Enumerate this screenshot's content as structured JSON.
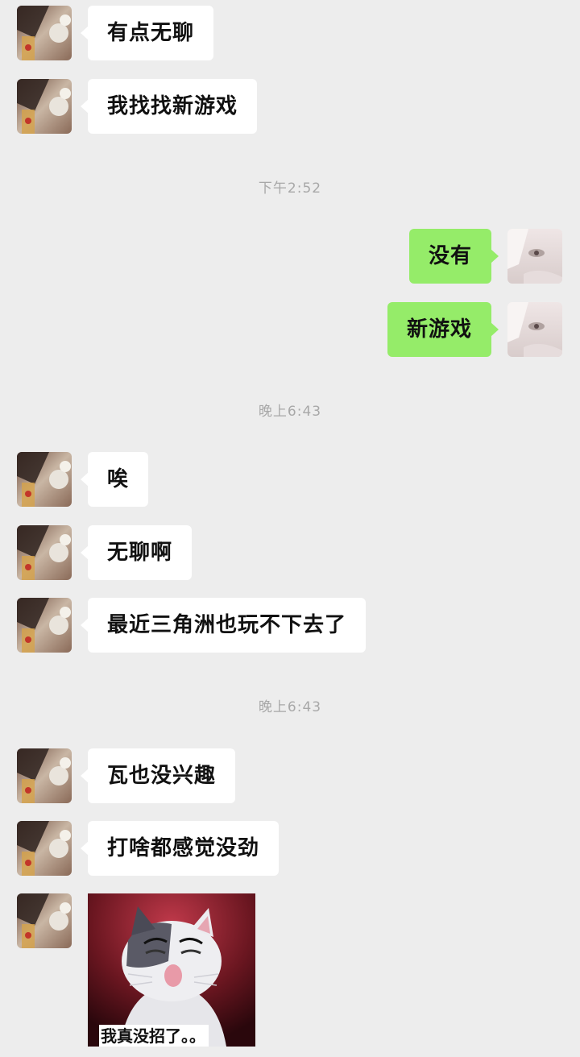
{
  "messages": [
    {
      "side": "incoming",
      "text": "有点无聊"
    },
    {
      "side": "incoming",
      "text": "我找找新游戏"
    },
    {
      "side": "outgoing",
      "text": "没有"
    },
    {
      "side": "outgoing",
      "text": "新游戏"
    },
    {
      "side": "incoming",
      "text": "唉"
    },
    {
      "side": "incoming",
      "text": "无聊啊"
    },
    {
      "side": "incoming",
      "text": "最近三角洲也玩不下去了"
    },
    {
      "side": "incoming",
      "text": "瓦也没兴趣"
    },
    {
      "side": "incoming",
      "text": "打啥都感觉没劲"
    }
  ],
  "timestamps": [
    "下午2:52",
    "晚上6:43",
    "晚上6:43"
  ],
  "sticker": {
    "caption": "我真没招了。。"
  },
  "colors": {
    "background": "#ededed",
    "incoming_bubble": "#ffffff",
    "outgoing_bubble": "#95ec69",
    "timestamp_text": "#a8a8a8"
  }
}
